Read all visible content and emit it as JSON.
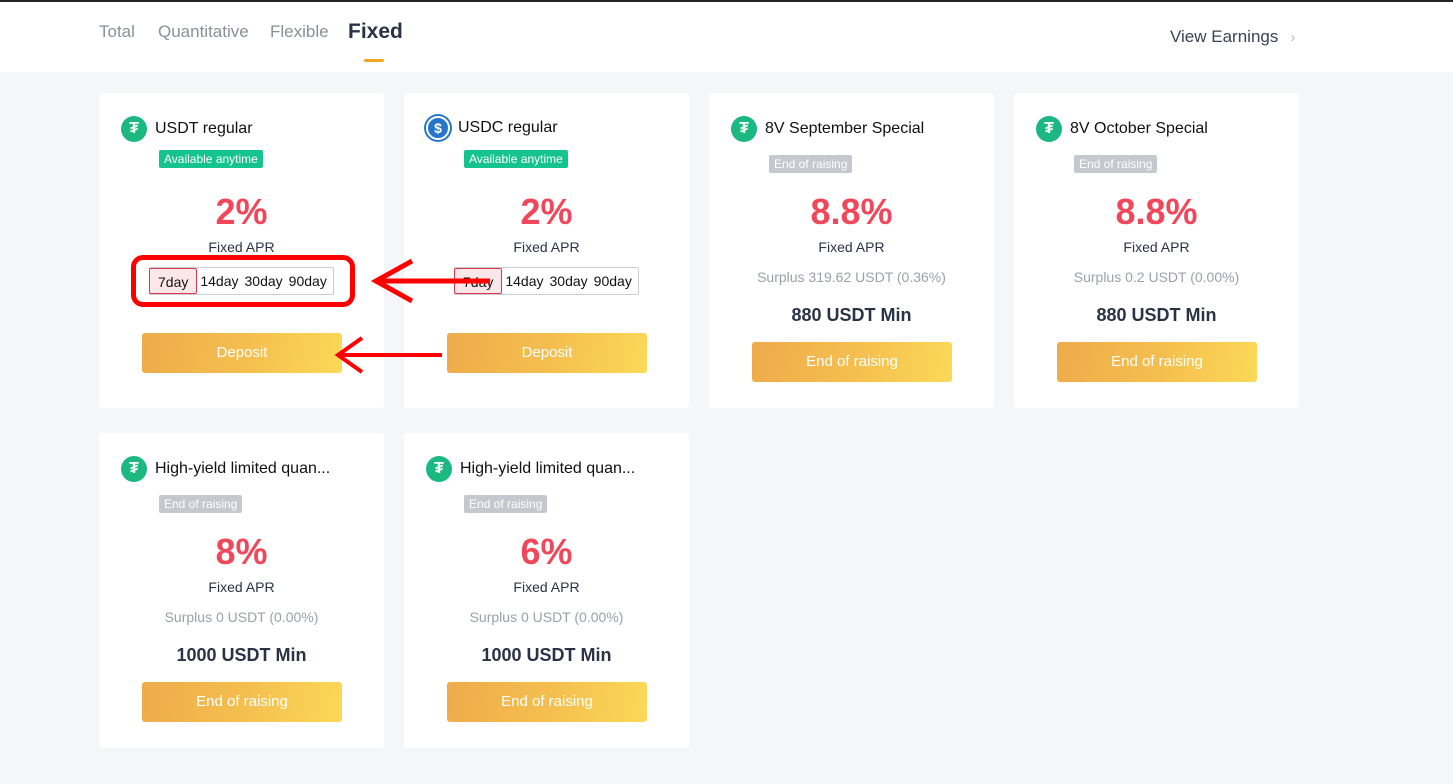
{
  "tabs": [
    {
      "label": "Total",
      "active": false
    },
    {
      "label": "Quantitative",
      "active": false
    },
    {
      "label": "Flexible",
      "active": false
    },
    {
      "label": "Fixed",
      "active": true
    }
  ],
  "header": {
    "view_earnings": "View Earnings",
    "chevron": "›"
  },
  "colors": {
    "accent": "#f5a623",
    "rate": "#f0475b",
    "available_badge": "#14c38e",
    "ended_badge": "#c5c8cf",
    "usdt": "#1bb981",
    "usdc": "#2775ca",
    "annotation": "#ff0000"
  },
  "cards": [
    {
      "coin": "usdt-icon",
      "coin_glyph": "₮",
      "title": "USDT regular",
      "badge": "Available anytime",
      "rate": "2%",
      "rate_label": "Fixed APR",
      "periods": [
        "7day",
        "14day",
        "30day",
        "90day"
      ],
      "selected_period": "7day",
      "button": "Deposit"
    },
    {
      "coin": "usdc-icon",
      "coin_glyph": "$",
      "title": "USDC regular",
      "badge": "Available anytime",
      "rate": "2%",
      "rate_label": "Fixed APR",
      "periods": [
        "7day",
        "14day",
        "30day",
        "90day"
      ],
      "selected_period": "7day",
      "button": "Deposit"
    },
    {
      "coin": "usdt-icon",
      "coin_glyph": "₮",
      "title": "8V September Special",
      "badge": "End of raising",
      "rate": "8.8%",
      "rate_label": "Fixed APR",
      "surplus": "Surplus 319.62 USDT (0.36%)",
      "min": "880 USDT Min",
      "button": "End of raising"
    },
    {
      "coin": "usdt-icon",
      "coin_glyph": "₮",
      "title": "8V October Special",
      "badge": "End of raising",
      "rate": "8.8%",
      "rate_label": "Fixed APR",
      "surplus": "Surplus 0.2 USDT (0.00%)",
      "min": "880 USDT Min",
      "button": "End of raising"
    },
    {
      "coin": "usdt-icon",
      "coin_glyph": "₮",
      "title": "High-yield limited quan...",
      "badge": "End of raising",
      "rate": "8%",
      "rate_label": "Fixed APR",
      "surplus": "Surplus 0 USDT (0.00%)",
      "min": "1000 USDT Min",
      "button": "End of raising"
    },
    {
      "coin": "usdt-icon",
      "coin_glyph": "₮",
      "title": "High-yield limited quan...",
      "badge": "End of raising",
      "rate": "6%",
      "rate_label": "Fixed APR",
      "surplus": "Surplus 0 USDT (0.00%)",
      "min": "1000 USDT Min",
      "button": "End of raising"
    }
  ]
}
